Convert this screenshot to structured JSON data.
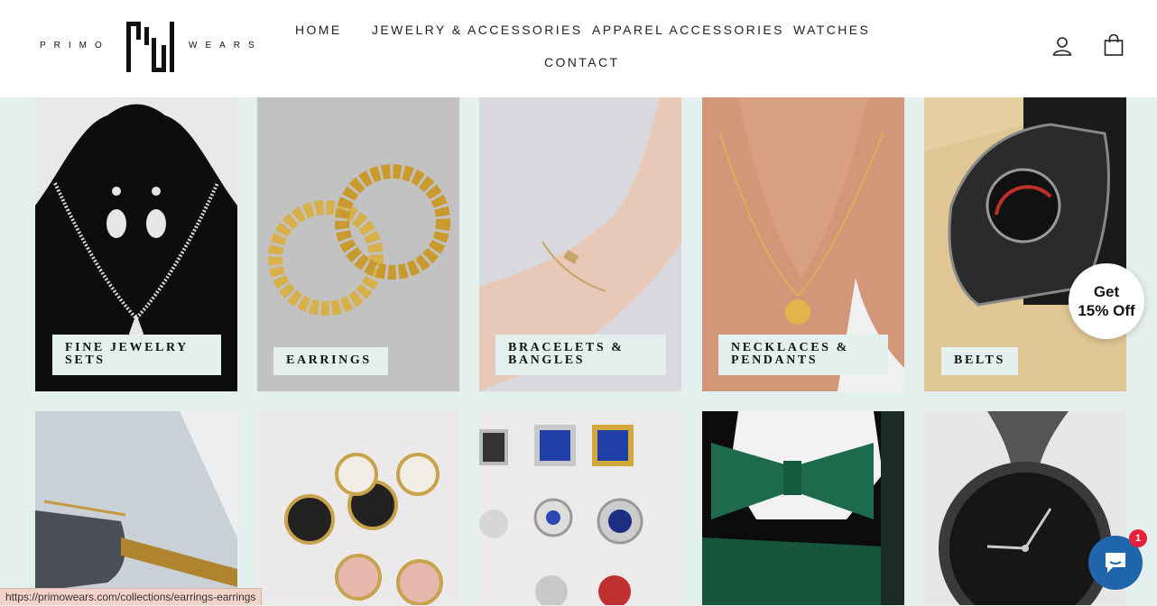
{
  "brand": {
    "left": "PRIMO",
    "right": "WEARS",
    "logo_icon": "pw-monogram-logo"
  },
  "nav": {
    "items": [
      {
        "label": "HOME"
      },
      {
        "label": "JEWELRY & ACCESSORIES"
      },
      {
        "label": "APPAREL ACCESSORIES"
      },
      {
        "label": "WATCHES"
      },
      {
        "label": "CONTACT"
      }
    ],
    "icons": [
      "account-icon",
      "cart-icon"
    ]
  },
  "collections_row1": [
    {
      "label_line1": "FINE JEWELRY",
      "label_line2": "SETS"
    },
    {
      "label_line1": "EARRINGS",
      "label_line2": ""
    },
    {
      "label_line1": "BRACELETS &",
      "label_line2": "BANGLES"
    },
    {
      "label_line1": "NECKLACES &",
      "label_line2": "PENDANTS"
    },
    {
      "label_line1": "BELTS",
      "label_line2": ""
    }
  ],
  "collections_row2": [
    {
      "image": "rimless-sunglasses"
    },
    {
      "image": "round-sunglasses"
    },
    {
      "image": "cufflinks"
    },
    {
      "image": "bow-ties"
    },
    {
      "image": "black-watch"
    }
  ],
  "promo": {
    "line1": "Get",
    "line2": "15% Off"
  },
  "chat": {
    "badge_count": "1",
    "icon": "chat-icon"
  },
  "status_url": "https://primowears.com/collections/earrings-earrings",
  "colors": {
    "page_bg": "#e3f0ee",
    "header_bg": "#ffffff",
    "chat_blue": "#1f66ad",
    "badge_red": "#e5203a"
  }
}
